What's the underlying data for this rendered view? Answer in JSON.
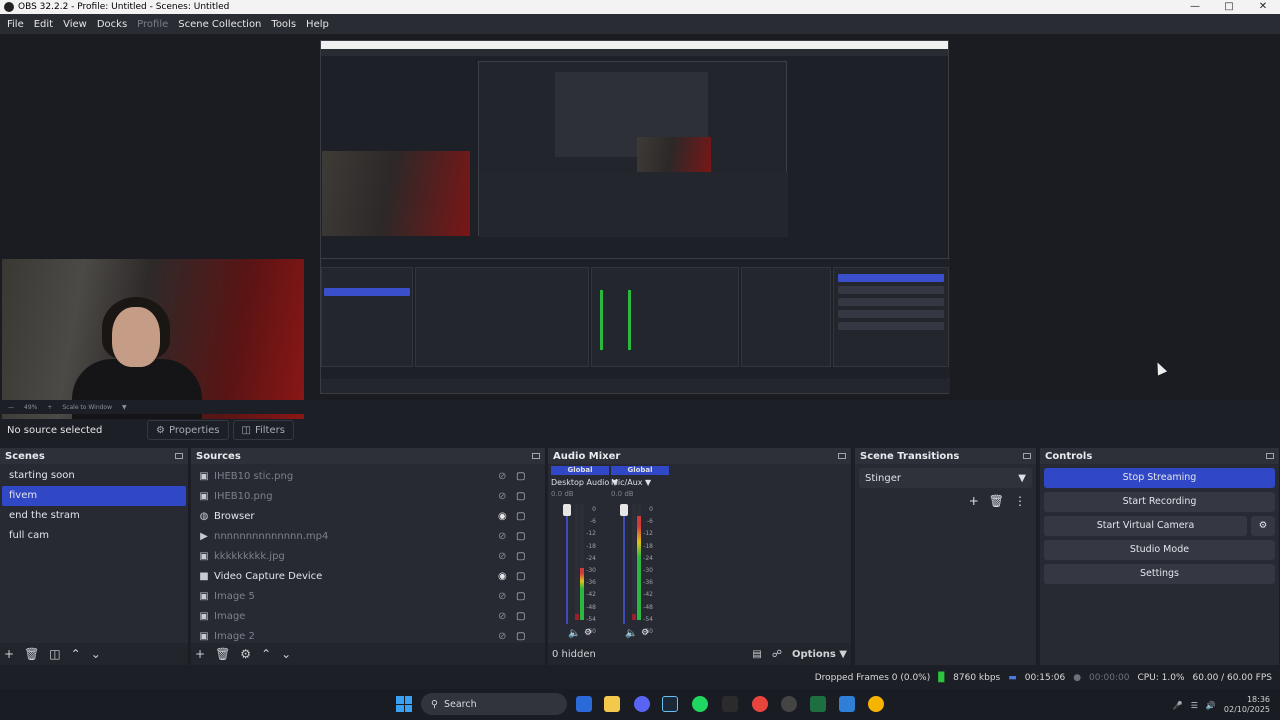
{
  "window": {
    "title": "OBS 32.2.2 - Profile: Untitled - Scenes: Untitled",
    "minimize": "—",
    "maximize": "□",
    "close": "✕"
  },
  "menu": [
    "File",
    "Edit",
    "View",
    "Docks",
    "Profile",
    "Scene Collection",
    "Tools",
    "Help"
  ],
  "zoombar": {
    "zoom": "49%",
    "scale_mode": "Scale to Window"
  },
  "source_toolbar": {
    "no_source": "No source selected",
    "properties": "Properties",
    "filters": "Filters"
  },
  "scenes": {
    "title": "Scenes",
    "items": [
      "starting soon",
      "fivem",
      "end the stram",
      "full cam"
    ],
    "selected": "fivem"
  },
  "sources": {
    "title": "Sources",
    "items": [
      {
        "name": "IHEB10 stic.png",
        "icon": "image-icon",
        "visible": false
      },
      {
        "name": "IHEB10.png",
        "icon": "image-icon",
        "visible": false
      },
      {
        "name": "Browser",
        "icon": "browser-globe-icon",
        "visible": true
      },
      {
        "name": "nnnnnnnnnnnnnn.mp4",
        "icon": "play-icon",
        "visible": false
      },
      {
        "name": "kkkkkkkkk.jpg",
        "icon": "image-icon",
        "visible": false
      },
      {
        "name": "Video Capture Device",
        "icon": "camera-icon",
        "visible": true
      },
      {
        "name": "Image 5",
        "icon": "image-icon",
        "visible": false
      },
      {
        "name": "Image",
        "icon": "image-icon",
        "visible": false
      },
      {
        "name": "Image 2",
        "icon": "image-icon",
        "visible": false
      }
    ]
  },
  "mixer": {
    "title": "Audio Mixer",
    "channels": [
      {
        "badge": "Global",
        "name": "Desktop Audio",
        "db": "0.0 dB",
        "level_left": 0.05,
        "level_right": 0.45
      },
      {
        "badge": "Global",
        "name": "Mic/Aux",
        "db": "0.0 dB",
        "level_left": 0.05,
        "level_right": 0.9
      }
    ],
    "ticks": [
      "0",
      "-6",
      "-12",
      "-18",
      "-24",
      "-30",
      "-36",
      "-42",
      "-48",
      "-54",
      "-60"
    ],
    "hidden": "0 hidden",
    "options": "Options"
  },
  "transitions": {
    "title": "Scene Transitions",
    "selected": "Stinger"
  },
  "controls": {
    "title": "Controls",
    "buttons": [
      "Stop Streaming",
      "Start Recording",
      "Start Virtual Camera",
      "Studio Mode",
      "Settings"
    ]
  },
  "status": {
    "dropped": "Dropped Frames 0 (0.0%)",
    "kbps": "8760 kbps",
    "stream_time": "00:15:06",
    "rec_time": "00:00:00",
    "cpu": "CPU: 1.0%",
    "fps": "60.00 / 60.00 FPS"
  },
  "taskbar": {
    "search_placeholder": "Search",
    "time": "18:36",
    "date": "02/10/2025"
  },
  "colors": {
    "accent": "#3148c6",
    "panel": "#272a33",
    "background": "#1d1f26",
    "streaming_green": "#2bc43e"
  }
}
